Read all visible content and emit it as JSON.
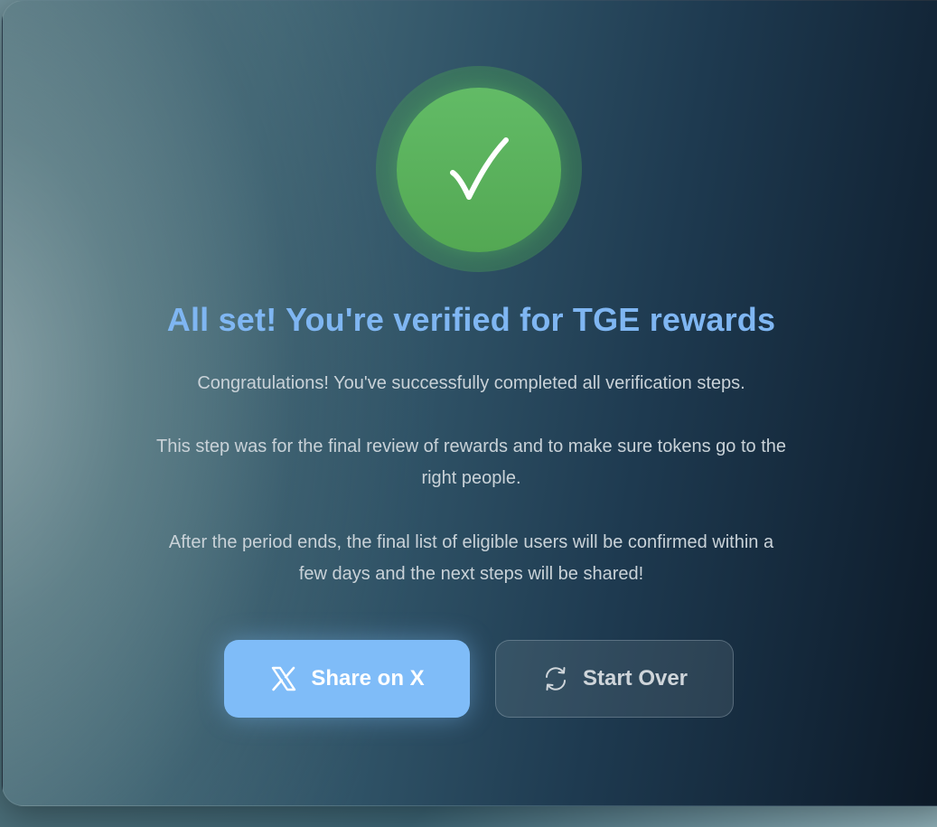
{
  "status": {
    "icon": "checkmark-icon",
    "accent_color": "#5cb85c"
  },
  "title": "All set! You're verified for TGE rewards",
  "paragraphs": {
    "p1": "Congratulations! You've successfully completed all verification steps.",
    "p2_line1": "This step was for the final review of rewards and to make sure tokens go to the",
    "p2_line2": "right people.",
    "p3_line1": "After the period ends, the final list of eligible users will be confirmed within a",
    "p3_line2": "few days and the next steps will be shared!"
  },
  "buttons": {
    "share": {
      "label": "Share on X",
      "icon": "x-logo-icon",
      "color": "#7fbcf8"
    },
    "restart": {
      "label": "Start Over",
      "icon": "refresh-icon"
    }
  },
  "colors": {
    "title": "#7fb6f2",
    "body_text": "#c9d2d8"
  }
}
